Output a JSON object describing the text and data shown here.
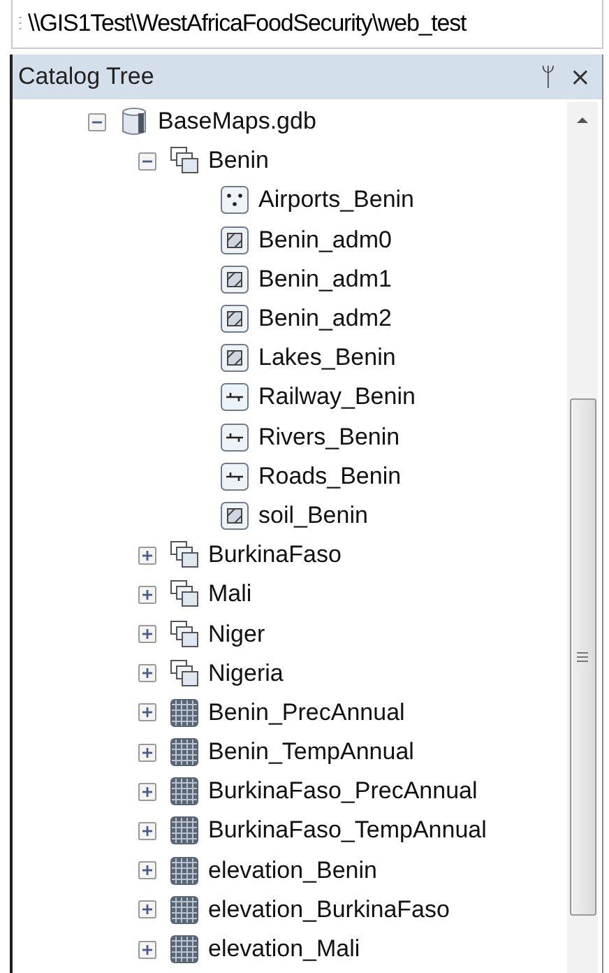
{
  "address_bar": {
    "path": "\\\\GIS1Test\\WestAfricaFoodSecurity\\web_test"
  },
  "panel": {
    "title": "Catalog Tree",
    "pin_glyph": "ᛘ",
    "close_glyph": "×"
  },
  "tree": [
    {
      "label": "BaseMaps.gdb",
      "kind": "database",
      "expanded": true,
      "children": [
        {
          "label": "Benin",
          "kind": "dataset",
          "expanded": true,
          "children": [
            {
              "label": "Airports_Benin",
              "kind": "point"
            },
            {
              "label": "Benin_adm0",
              "kind": "polygon"
            },
            {
              "label": "Benin_adm1",
              "kind": "polygon"
            },
            {
              "label": "Benin_adm2",
              "kind": "polygon"
            },
            {
              "label": "Lakes_Benin",
              "kind": "polygon"
            },
            {
              "label": "Railway_Benin",
              "kind": "line"
            },
            {
              "label": "Rivers_Benin",
              "kind": "line"
            },
            {
              "label": "Roads_Benin",
              "kind": "line"
            },
            {
              "label": "soil_Benin",
              "kind": "polygon"
            }
          ]
        },
        {
          "label": "BurkinaFaso",
          "kind": "dataset",
          "expanded": false
        },
        {
          "label": "Mali",
          "kind": "dataset",
          "expanded": false
        },
        {
          "label": "Niger",
          "kind": "dataset",
          "expanded": false
        },
        {
          "label": "Nigeria",
          "kind": "dataset",
          "expanded": false
        },
        {
          "label": "Benin_PrecAnnual",
          "kind": "raster",
          "expanded": false
        },
        {
          "label": "Benin_TempAnnual",
          "kind": "raster",
          "expanded": false
        },
        {
          "label": "BurkinaFaso_PrecAnnual",
          "kind": "raster",
          "expanded": false
        },
        {
          "label": "BurkinaFaso_TempAnnual",
          "kind": "raster",
          "expanded": false
        },
        {
          "label": "elevation_Benin",
          "kind": "raster",
          "expanded": false
        },
        {
          "label": "elevation_BurkinaFaso",
          "kind": "raster",
          "expanded": false
        },
        {
          "label": "elevation_Mali",
          "kind": "raster",
          "expanded": false
        }
      ]
    }
  ]
}
